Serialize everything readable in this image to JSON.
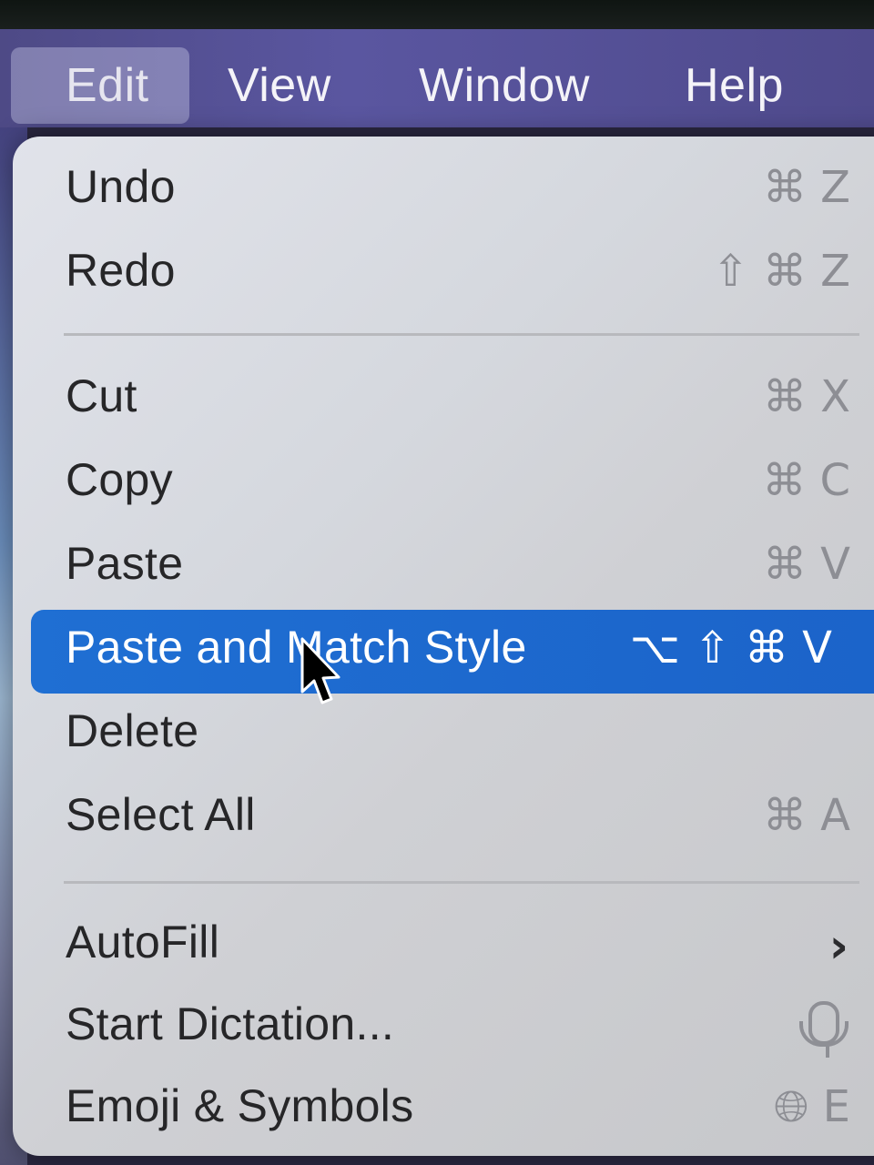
{
  "menubar": {
    "items": [
      {
        "label": "Edit"
      },
      {
        "label": "View"
      },
      {
        "label": "Window"
      },
      {
        "label": "Help"
      }
    ]
  },
  "menu": {
    "items": [
      {
        "label": "Undo",
        "shortcut": "⌘ Z"
      },
      {
        "label": "Redo",
        "shortcut": "⇧ ⌘ Z"
      },
      {
        "label": "Cut",
        "shortcut": "⌘ X"
      },
      {
        "label": "Copy",
        "shortcut": "⌘ C"
      },
      {
        "label": "Paste",
        "shortcut": "⌘ V"
      },
      {
        "label": "Paste and Match Style",
        "shortcut": "⌥ ⇧ ⌘ V"
      },
      {
        "label": "Delete",
        "shortcut": ""
      },
      {
        "label": "Select All",
        "shortcut": "⌘ A"
      },
      {
        "label": "AutoFill",
        "icon": "chevron-right-icon"
      },
      {
        "label": "Start Dictation...",
        "icon": "microphone-icon"
      },
      {
        "label": "Emoji & Symbols",
        "icon": "globe-icon",
        "shortcut": "E"
      }
    ]
  },
  "colors": {
    "highlight": "#1f6fd3",
    "menubar": "#5a56a0"
  }
}
